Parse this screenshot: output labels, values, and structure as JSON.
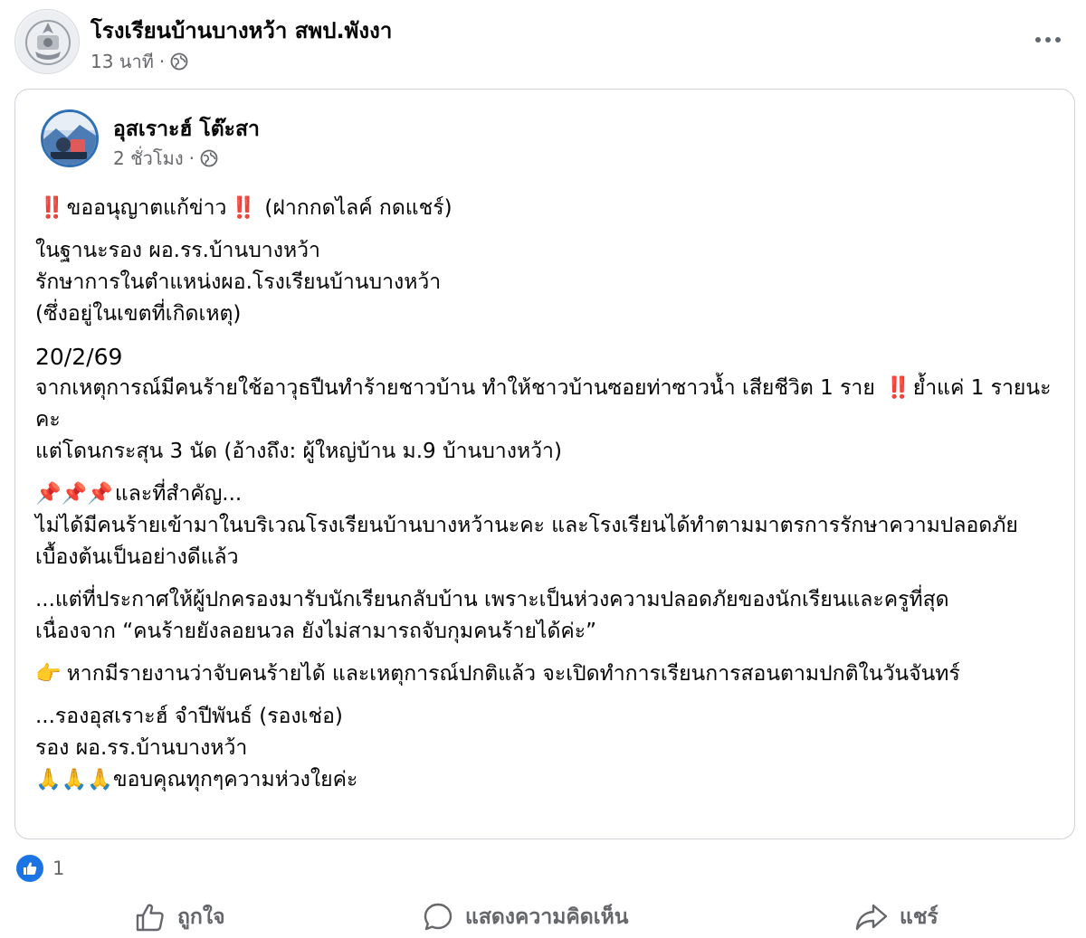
{
  "post": {
    "page_name": "โรงเรียนบ้านบางหว้า สพป.พังงา",
    "time": "13 นาที",
    "separator": "·",
    "privacy_icon": "globe-icon",
    "more_icon": "more-options-icon"
  },
  "shared_post": {
    "author_name": "อุสเราะฮ์ โต๊ะสา",
    "time": "2 ชั่วโมง",
    "separator": "·",
    "privacy_icon": "globe-icon",
    "body": {
      "p1": {
        "emoji_start": "‼️",
        "text": "ขออนุญาตแก้ข่าว",
        "emoji_end": "‼️",
        "text_after": " (ฝากกดไลค์ กดแชร์)"
      },
      "p2": [
        "ในฐานะรอง ผอ.รร.บ้านบางหว้า",
        "รักษาการในตำแหน่งผอ.โรงเรียนบ้านบางหว้า",
        "(ซึ่งอยู่ในเขตที่เกิดเหตุ)"
      ],
      "p3": {
        "date": "20/2/69",
        "line1_before": "จากเหตุการณ์มีคนร้ายใช้อาวุธปืนทำร้ายชาวบ้าน ทำให้ชาวบ้านซอยท่าซาวน้ำ เสียชีวิต 1 ราย ",
        "line1_emoji": "‼️",
        "line1_after": "ย้ำแค่ 1 รายนะคะ",
        "line2": "แต่โดนกระสุน 3 นัด (อ้างถึง: ผู้ใหญ่บ้าน ม.9 บ้านบางหว้า)"
      },
      "p4": {
        "emoji": "📌📌📌",
        "heading": "และที่สำคัญ...",
        "text": "ไม่ได้มีคนร้ายเข้ามาในบริเวณโรงเรียนบ้านบางหว้านะคะ และโรงเรียนได้ทำตามมาตรการรักษาความปลอดภัยเบื้องต้นเป็นอย่างดีแล้ว"
      },
      "p5": {
        "line1": "...แต่ที่ประกาศให้ผู้ปกครองมารับนักเรียนกลับบ้าน เพราะเป็นห่วงความปลอดภัยของนักเรียนและครูที่สุด",
        "line2": "เนื่องจาก “คนร้ายยังลอยนวล ยังไม่สามารถจับกุมคนร้ายได้ค่ะ”"
      },
      "p6": {
        "emoji": "👉",
        "text": "หากมีรายงานว่าจับคนร้ายได้ และเหตุการณ์ปกติแล้ว จะเปิดทำการเรียนการสอนตามปกติในวันจันทร์"
      },
      "p7": {
        "line1": "...รองอุสเราะฮ์ จำปีพันธ์ (รองเช่อ)",
        "line2": "รอง ผอ.รร.บ้านบางหว้า",
        "emoji": "🙏🙏🙏",
        "line3": "ขอบคุณทุกๆความห่วงใยค่ะ"
      }
    }
  },
  "reactions": {
    "icon": "like-reaction-icon",
    "count": "1"
  },
  "actions": {
    "like_label": "ถูกใจ",
    "comment_label": "แสดงความคิดเห็น",
    "share_label": "แชร์"
  },
  "colors": {
    "accent": "#1b74e4",
    "secondary_text": "#65676b",
    "alert_red": "#e0245e"
  }
}
